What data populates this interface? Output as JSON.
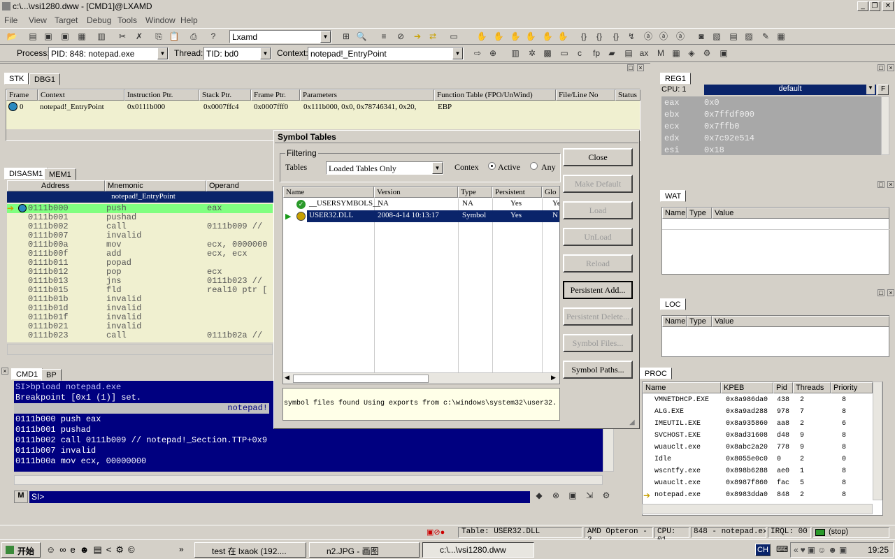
{
  "window": {
    "title": "c:\\...\\vsi1280.dww - [CMD1]@LXAMD"
  },
  "menu": [
    "File",
    "View",
    "Target",
    "Debug",
    "Tools",
    "Window",
    "Help"
  ],
  "toolbar": {
    "target_value": "Lxamd"
  },
  "toolbar2": {
    "process_label": "Process:",
    "process_value": "PID: 848: notepad.exe",
    "thread_label": "Thread:",
    "thread_value": "TID: bd0",
    "context_label": "Context:",
    "context_value": "notepad!_EntryPoint"
  },
  "stk": {
    "tabs": [
      "STK",
      "DBG1"
    ],
    "columns": [
      "Frame",
      "Context",
      "Instruction Ptr.",
      "Stack Ptr.",
      "Frame Ptr.",
      "Parameters",
      "Function Table (FPO/UnWind)",
      "File/Line No",
      "Status"
    ],
    "row": [
      "0",
      "notepad!_EntryPoint",
      "0x0111b000",
      "0x0007ffc4",
      "0x0007fff0",
      "0x111b000, 0x0, 0x78746341, 0x20,",
      "EBP",
      "",
      ""
    ]
  },
  "disasm": {
    "tabs": [
      "DISASM1",
      "MEM1"
    ],
    "columns": [
      "Address",
      "Mnemonic",
      "Operand"
    ],
    "banner": "notepad!_EntryPoint",
    "rows": [
      [
        "0111b000",
        "push",
        "eax"
      ],
      [
        "0111b001",
        "pushad",
        ""
      ],
      [
        "0111b002",
        "call",
        "0111b009 //"
      ],
      [
        "0111b007",
        "invalid",
        ""
      ],
      [
        "0111b00a",
        "mov",
        "ecx, 0000000"
      ],
      [
        "0111b00f",
        "add",
        "ecx, ecx"
      ],
      [
        "0111b011",
        "popad",
        ""
      ],
      [
        "0111b012",
        "pop",
        "ecx"
      ],
      [
        "0111b013",
        "jns",
        "0111b023 //"
      ],
      [
        "0111b015",
        "fld",
        "real10 ptr ["
      ],
      [
        "0111b01b",
        "invalid",
        ""
      ],
      [
        "0111b01d",
        "invalid",
        ""
      ],
      [
        "0111b01f",
        "invalid",
        ""
      ],
      [
        "0111b021",
        "invalid",
        ""
      ],
      [
        "0111b023",
        "call",
        "0111b02a //"
      ]
    ]
  },
  "cmd": {
    "tabs": [
      "CMD1",
      "BP"
    ],
    "lines": [
      "SI>bpload notepad.exe",
      "Breakpoint [0x1 (1)] set."
    ],
    "banner": "notepad!",
    "asm": [
      "0111b000   push   eax",
      "0111b001   pushad",
      "0111b002   call   0111b009 // notepad!_Section.TTP+0x9",
      "0111b007   invalid",
      "0111b00a   mov    ecx, 00000000"
    ],
    "prompt": "SI>"
  },
  "reg": {
    "tab": "REG1",
    "cpu_label": "CPU: 1",
    "profile": "default",
    "f_btn": "F",
    "rows": [
      [
        "eax",
        "0x0"
      ],
      [
        "ebx",
        "0x7ffdf000"
      ],
      [
        "ecx",
        "0x7ffb0"
      ],
      [
        "edx",
        "0x7c92e514"
      ],
      [
        "esi",
        "0x18"
      ]
    ]
  },
  "wat": {
    "tab": "WAT",
    "columns": [
      "Name",
      "Type",
      "Value"
    ]
  },
  "loc": {
    "tab": "LOC",
    "columns": [
      "Name",
      "Type",
      "Value"
    ]
  },
  "proc": {
    "tab": "PROC",
    "columns": [
      "Name",
      "KPEB",
      "Pid",
      "Threads",
      "Priority"
    ],
    "rows": [
      [
        "VMNETDHCP.EXE",
        "0x8a986da0",
        "438",
        "2",
        "8"
      ],
      [
        "ALG.EXE",
        "0x8a9ad288",
        "978",
        "7",
        "8"
      ],
      [
        "IMEUTIL.EXE",
        "0x8a935860",
        "aa8",
        "2",
        "6"
      ],
      [
        "SVCHOST.EXE",
        "0x8ad31608",
        "d48",
        "9",
        "8"
      ],
      [
        "wuauclt.exe",
        "0x8abc2a20",
        "778",
        "9",
        "8"
      ],
      [
        "Idle",
        "0x8055e0c0",
        "0",
        "2",
        "0"
      ],
      [
        "wscntfy.exe",
        "0x898b6288",
        "ae0",
        "1",
        "8"
      ],
      [
        "wuauclt.exe",
        "0x8987f860",
        "fac",
        "5",
        "8"
      ],
      [
        "notepad.exe",
        "0x8983dda0",
        "848",
        "2",
        "8"
      ]
    ]
  },
  "dialog": {
    "title": "Symbol Tables",
    "filtering": "Filtering",
    "tables_label": "Tables",
    "tables_value": "Loaded Tables Only",
    "context_label": "Contex",
    "active": "Active",
    "any": "Any",
    "columns": [
      "Name",
      "Version",
      "Type",
      "Persistent",
      "Glo"
    ],
    "rows": [
      [
        "__USERSYMBOLS__",
        "NA",
        "NA",
        "Yes",
        "Ye"
      ],
      [
        "USER32.DLL",
        "2008-4-14 10:13:17",
        "Symbol",
        "Yes",
        "N"
      ]
    ],
    "message": "symbol files found  Using exports from c:\\windows\\system32\\user32.",
    "buttons": [
      "Close",
      "Make Default",
      "Load",
      "UnLoad",
      "Reload",
      "Persistent Add...",
      "Persistent Delete...",
      "Symbol Files...",
      "Symbol Paths..."
    ]
  },
  "status": {
    "table": "Table: USER32.DLL",
    "cpu_model": "AMD Opteron - 2",
    "cpu": "CPU: 01",
    "process": "848 - notepad.exe",
    "irql": "IRQL: 00",
    "state": "(stop)"
  },
  "taskbar": {
    "start": "开始",
    "tasks": [
      "test 在 lxaok (192....",
      "n2.JPG - 画图",
      "c:\\...\\vsi1280.dww"
    ],
    "lang": "CH",
    "time": "19:25"
  },
  "colors": {
    "navy": "#0a246a",
    "cmd_bg": "#000080",
    "highlight_row": "#80ff80",
    "grid_bg": "#f0f0d0",
    "reg_bg": "#a8a8a8"
  }
}
